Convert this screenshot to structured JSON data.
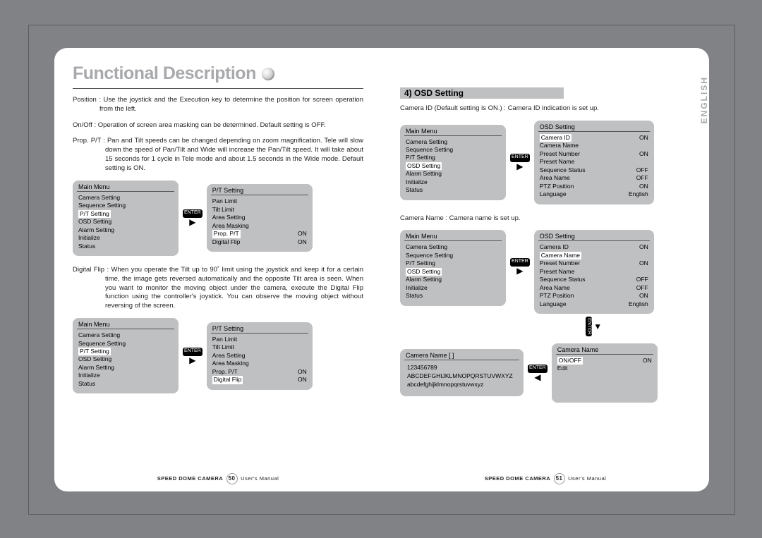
{
  "title": "Functional Description",
  "language_tab": "ENGLISH",
  "left": {
    "para_position": "Position : Use the joystick and the Execution key to determine the position for screen operation from the left.",
    "para_onoff": "On/Off : Operation of screen area masking can be determined. Default setting is OFF.",
    "para_prop": "Prop. P/T : Pan and Tilt speeds can be changed depending on zoom magnification. Tele will slow down the speed of Pan/Tilt and Wide will increase the Pan/Tilt speed. It will take about 15 seconds for 1 cycle in Tele mode and about 1.5 seconds in the Wide mode. Default setting is ON.",
    "para_flip": "Digital Flip : When you operate the Tilt up to 90˚ limit using the joystick and keep it for a certain time, the image gets reversed automatically and the opposite Tilt area is seen. When you want to monitor the moving object under the camera, execute the Digital Flip function using the controller's joystick. You can observe the moving object without reversing of the screen.",
    "main_menu_title": "Main Menu",
    "main_menu_items": [
      "Camera Setting",
      "Sequence Setting",
      "P/T Setting",
      "OSD Setting",
      "Alarm Setting",
      "Initialize",
      "Status"
    ],
    "pt_setting_title": "P/T Setting",
    "pt_items": [
      "Pan Limit",
      "Tilt Limit",
      "Area Setting",
      "Area Masking",
      "Prop. P/T",
      "Digital Flip"
    ],
    "on": "ON",
    "enter": "ENTER",
    "footer_product": "SPEED DOME CAMERA",
    "footer_doc": "User's Manual",
    "page_a": "50",
    "page_b": "51"
  },
  "right": {
    "section4": "4) OSD Setting",
    "cam_id_desc": "Camera ID (Default setting is ON.) : Camera ID indication is set up.",
    "cam_name_desc": "Camera Name : Camera name is set up.",
    "osd_title": "OSD Setting",
    "osd_items": [
      {
        "l": "Camera ID",
        "v": "ON"
      },
      {
        "l": "Camera Name",
        "v": ""
      },
      {
        "l": "Preset Number",
        "v": "ON"
      },
      {
        "l": "Preset Name",
        "v": ""
      },
      {
        "l": "Sequence Status",
        "v": "OFF"
      },
      {
        "l": "Area Name",
        "v": "OFF"
      },
      {
        "l": "PTZ Position",
        "v": "ON"
      },
      {
        "l": "Language",
        "v": "English"
      }
    ],
    "camname_box_title": "Camera Name  [          ]",
    "charrow1": "123456789",
    "charrow2": "ABCDEFGHIJKLMNOPQRSTUVWXYZ",
    "charrow3": "abcdefghijklmnopqrstuvwxyz",
    "camname_menu_title": "Camera Name",
    "camname_menu_items": [
      {
        "l": "ON/OFF",
        "v": "ON"
      },
      {
        "l": "Edit",
        "v": ""
      }
    ]
  }
}
